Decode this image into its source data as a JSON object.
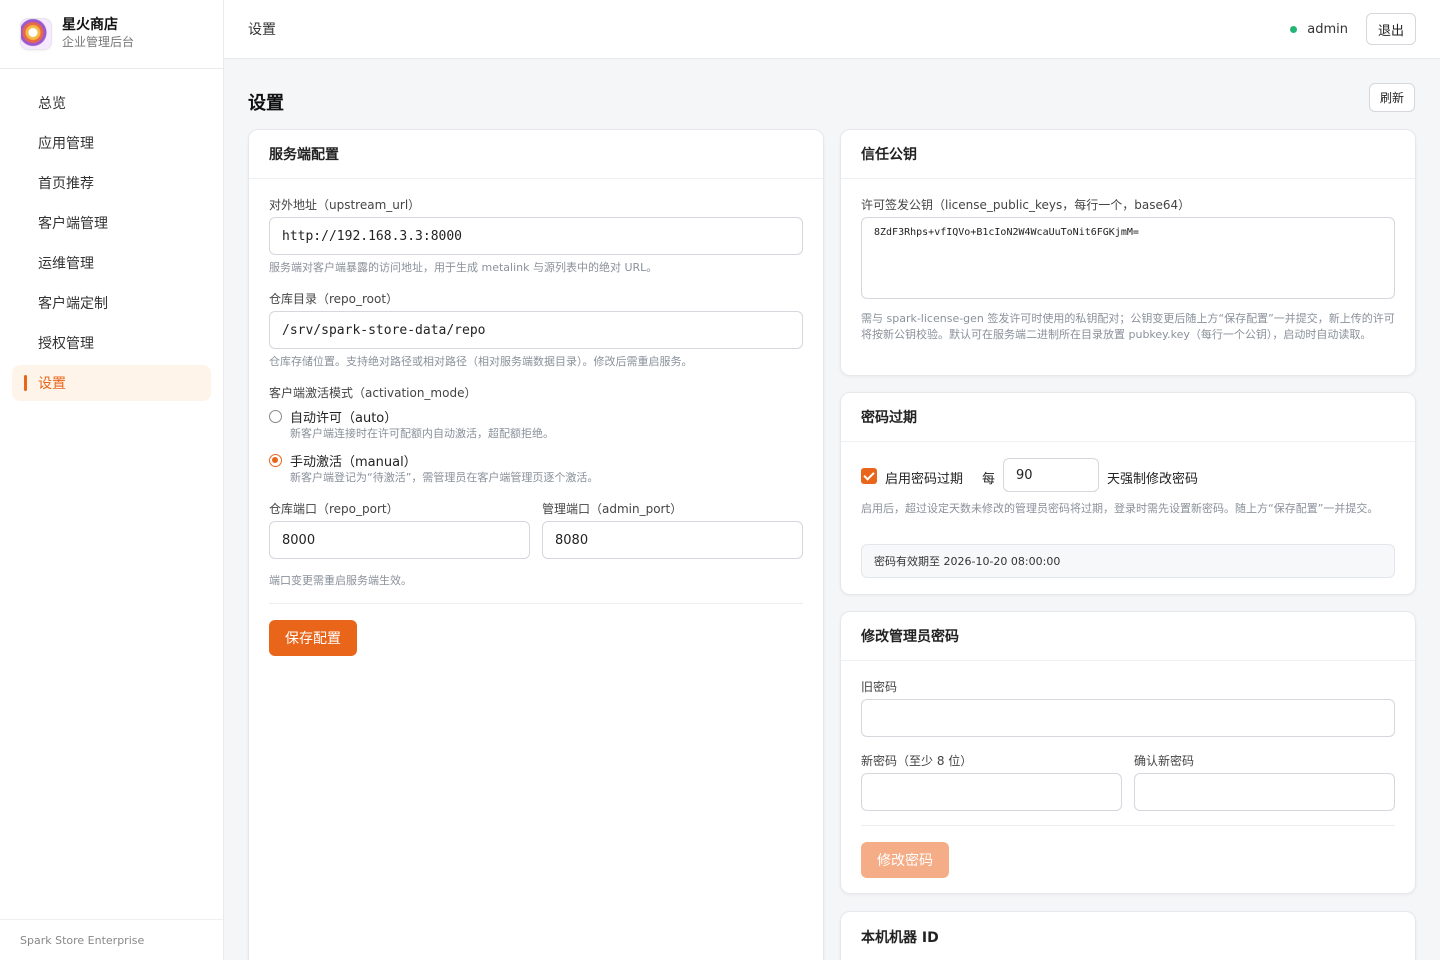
{
  "brand": {
    "name": "星火商店",
    "subtitle": "企业管理后台"
  },
  "nav": {
    "items": [
      {
        "label": "总览"
      },
      {
        "label": "应用管理"
      },
      {
        "label": "首页推荐"
      },
      {
        "label": "客户端管理"
      },
      {
        "label": "运维管理"
      },
      {
        "label": "客户端定制"
      },
      {
        "label": "授权管理"
      },
      {
        "label": "设置",
        "active": true
      }
    ]
  },
  "footer": "Spark Store Enterprise",
  "topbar": {
    "breadcrumb": "设置",
    "user": "admin",
    "logout": "退出",
    "status_color": "#22b573"
  },
  "page": {
    "title": "设置",
    "refresh": "刷新"
  },
  "server": {
    "title": "服务端配置",
    "upstream_label": "对外地址（upstream_url）",
    "upstream_value": "http://192.168.3.3:8000",
    "upstream_hint": "服务端对客户端暴露的访问地址，用于生成 metalink 与源列表中的绝对 URL。",
    "repo_root_label": "仓库目录（repo_root）",
    "repo_root_value": "/srv/spark-store-data/repo",
    "repo_root_hint": "仓库存储位置。支持绝对路径或相对路径（相对服务端数据目录）。修改后需重启服务。",
    "activation_label": "客户端激活模式（activation_mode）",
    "auto_label": "自动许可（auto）",
    "auto_hint": "新客户端连接时在许可配额内自动激活，超配额拒绝。",
    "manual_label": "手动激活（manual）",
    "manual_hint": "新客户端登记为“待激活”，需管理员在客户端管理页逐个激活。",
    "selected_mode": "manual",
    "repo_port_label": "仓库端口（repo_port）",
    "repo_port_value": "8000",
    "admin_port_label": "管理端口（admin_port）",
    "admin_port_value": "8080",
    "port_hint": "端口变更需重启服务端生效。",
    "save": "保存配置"
  },
  "trust": {
    "title": "信任公钥",
    "label": "许可签发公钥（license_public_keys，每行一个，base64）",
    "value": "8ZdF3Rhps+vfIQVo+B1cIoN2W4WcaUuToNit6FGKjmM=",
    "hint": "需与 spark-license-gen 签发许可时使用的私钥配对；公钥变更后随上方“保存配置”一并提交，新上传的许可将按新公钥校验。默认可在服务端二进制所在目录放置 pubkey.key（每行一个公钥），启动时自动读取。"
  },
  "expiry": {
    "title": "密码过期",
    "enable_label": "启用密码过期",
    "enabled": true,
    "every": "每",
    "days": "90",
    "suffix": "天强制修改密码",
    "hint": "启用后，超过设定天数未修改的管理员密码将过期，登录时需先设置新密码。随上方“保存配置”一并提交。",
    "status": "密码有效期至 2026-10-20 08:00:00"
  },
  "change_pw": {
    "title": "修改管理员密码",
    "old_label": "旧密码",
    "new_label": "新密码（至少 8 位）",
    "confirm_label": "确认新密码",
    "submit": "修改密码"
  },
  "machine": {
    "title": "本机机器 ID"
  },
  "colors": {
    "accent": "#e8651a",
    "accent_disabled": "#f4ad86"
  }
}
